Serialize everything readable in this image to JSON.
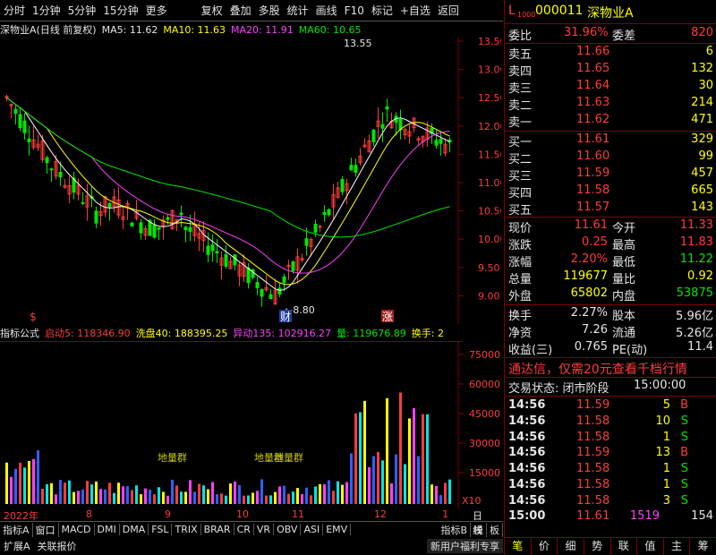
{
  "toolbar": [
    "分时",
    "1分钟",
    "5分钟",
    "15分钟",
    "更多",
    "复权",
    "叠加",
    "多股",
    "统计",
    "画线",
    "F10",
    "标记",
    "+自选",
    "返回"
  ],
  "info": {
    "title": "深物业A(日线 前复权)",
    "ma5": "MA5: 11.62",
    "ma10": "MA10: 11.63",
    "ma20": "MA20: 11.91",
    "ma60": "MA60: 10.65"
  },
  "prices": [
    "13.50",
    "13.00",
    "12.50",
    "12.00",
    "11.50",
    "11.00",
    "10.50",
    "10.00",
    "9.50",
    "9.00"
  ],
  "high_label": "13.55",
  "low_label": "8.80",
  "mark_cai": "财",
  "mark_zhang": "涨",
  "mark_dollar": "$",
  "indicator": {
    "label": "指标公式",
    "qd": "启动5: 118346.90",
    "xp": "洗盘40: 188395.25",
    "yd": "异动135: 102916.27",
    "liang": "量: 119676.89",
    "hs": "换手: 2"
  },
  "vol_axis": [
    "75000",
    "60000",
    "45000",
    "30000",
    "15000"
  ],
  "vol_unit": "X10",
  "vol_labels": [
    "地量群",
    "地量群",
    "地量群"
  ],
  "time_axis": [
    "2022年",
    "8",
    "9",
    "10",
    "11",
    "12",
    "1",
    "日线"
  ],
  "tabs": [
    "指标A",
    "窗口",
    "MACD",
    "DMI",
    "DMA",
    "FSL",
    "TRIX",
    "BRAR",
    "CR",
    "VR",
    "OBV",
    "ASI",
    "EMV",
    "指标B",
    "模",
    "板"
  ],
  "status": {
    "left1": "扩展A",
    "left2": "关联报价",
    "right": "新用户福利专享"
  },
  "stock": {
    "code": "000011",
    "name": "深物业A",
    "l": "L",
    "sub": "1000"
  },
  "weibi": {
    "label": "委比",
    "value": "31.96%",
    "label2": "委差",
    "value2": "820"
  },
  "sells": [
    {
      "n": "卖五",
      "p": "11.66",
      "v": "6"
    },
    {
      "n": "卖四",
      "p": "11.65",
      "v": "132"
    },
    {
      "n": "卖三",
      "p": "11.64",
      "v": "30"
    },
    {
      "n": "卖二",
      "p": "11.63",
      "v": "214"
    },
    {
      "n": "卖一",
      "p": "11.62",
      "v": "471"
    }
  ],
  "buys": [
    {
      "n": "买一",
      "p": "11.61",
      "v": "329"
    },
    {
      "n": "买二",
      "p": "11.60",
      "v": "99"
    },
    {
      "n": "买三",
      "p": "11.59",
      "v": "457"
    },
    {
      "n": "买四",
      "p": "11.58",
      "v": "665"
    },
    {
      "n": "买五",
      "p": "11.57",
      "v": "143"
    }
  ],
  "quote": [
    {
      "a": "现价",
      "av": "11.61",
      "b": "今开",
      "bv": "11.33"
    },
    {
      "a": "涨跌",
      "av": "0.25",
      "b": "最高",
      "bv": "11.83"
    },
    {
      "a": "涨幅",
      "av": "2.20%",
      "b": "最低",
      "bv": "11.22"
    },
    {
      "a": "总量",
      "av": "119677",
      "b": "量比",
      "bv": "0.92"
    },
    {
      "a": "外盘",
      "av": "65802",
      "b": "内盘",
      "bv": "53875"
    }
  ],
  "stats": [
    {
      "a": "换手",
      "av": "2.27%",
      "b": "股本",
      "bv": "5.96亿"
    },
    {
      "a": "净资",
      "av": "7.26",
      "b": "流通",
      "bv": "5.26亿"
    },
    {
      "a": "收益(三)",
      "av": "0.765",
      "b": "PE(动)",
      "bv": "11.4"
    }
  ],
  "ad": "通达信，仅需20元查看千档行情",
  "trade": {
    "label": "交易状态: 闭市阶段",
    "time": "15:00:00"
  },
  "ticks": [
    {
      "t": "14:56",
      "p": "11.59",
      "v": "5",
      "s": "B"
    },
    {
      "t": "14:56",
      "p": "11.58",
      "v": "10",
      "s": "S"
    },
    {
      "t": "14:56",
      "p": "11.58",
      "v": "1",
      "s": "S"
    },
    {
      "t": "14:56",
      "p": "11.59",
      "v": "13",
      "s": "B"
    },
    {
      "t": "14:56",
      "p": "11.58",
      "v": "1",
      "s": "S"
    },
    {
      "t": "14:56",
      "p": "11.58",
      "v": "1",
      "s": "S"
    },
    {
      "t": "14:56",
      "p": "11.58",
      "v": "3",
      "s": "S"
    }
  ],
  "last": {
    "t": "15:00",
    "p": "11.61",
    "v": "1519",
    "n": "154"
  },
  "bottom_tabs": [
    "笔",
    "价",
    "细",
    "势",
    "联",
    "值",
    "主",
    "筹"
  ],
  "colors": {
    "up": "#ff3c3c",
    "down": "#00e600",
    "ma5": "#ffffff",
    "ma10": "#ffff00",
    "ma20": "#ff40ff",
    "ma60": "#00e600"
  }
}
